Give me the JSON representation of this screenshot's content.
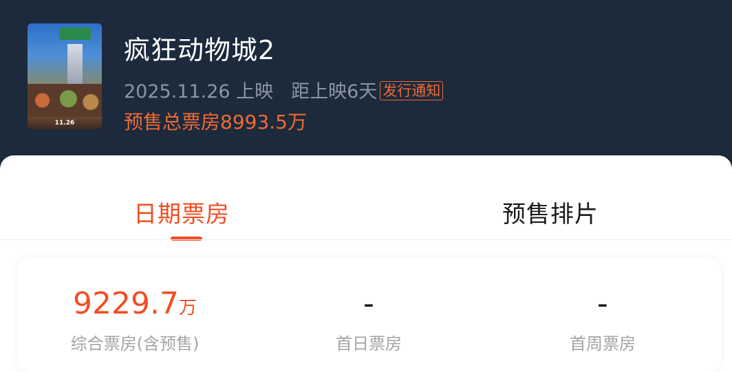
{
  "movie": {
    "title": "疯狂动物城2",
    "release_date": "2025.11.26 上映",
    "countdown": "距上映6天",
    "notify_label": "发行通知",
    "presale_total": "预售总票房8993.5万",
    "poster_date_text": "11.26"
  },
  "tabs": [
    {
      "label": "日期票房",
      "active": true
    },
    {
      "label": "预售排片",
      "active": false
    }
  ],
  "stats": [
    {
      "value": "9229.7",
      "unit": "万",
      "label": "综合票房(含预售)"
    },
    {
      "value": "-",
      "unit": "",
      "label": "首日票房"
    },
    {
      "value": "-",
      "unit": "",
      "label": "首周票房"
    }
  ],
  "colors": {
    "accent": "#f04e23",
    "header_bg": "#1c2a3c",
    "muted_text": "#8c96a3"
  }
}
